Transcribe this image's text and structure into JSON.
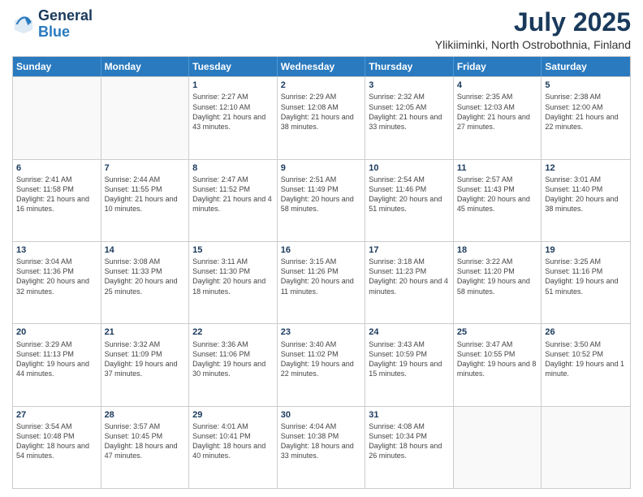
{
  "logo": {
    "line1": "General",
    "line2": "Blue"
  },
  "title": "July 2025",
  "subtitle": "Ylikiiminki, North Ostrobothnia, Finland",
  "header_days": [
    "Sunday",
    "Monday",
    "Tuesday",
    "Wednesday",
    "Thursday",
    "Friday",
    "Saturday"
  ],
  "weeks": [
    [
      {
        "day": "",
        "info": ""
      },
      {
        "day": "",
        "info": ""
      },
      {
        "day": "1",
        "info": "Sunrise: 2:27 AM\nSunset: 12:10 AM\nDaylight: 21 hours and 43 minutes."
      },
      {
        "day": "2",
        "info": "Sunrise: 2:29 AM\nSunset: 12:08 AM\nDaylight: 21 hours and 38 minutes."
      },
      {
        "day": "3",
        "info": "Sunrise: 2:32 AM\nSunset: 12:05 AM\nDaylight: 21 hours and 33 minutes."
      },
      {
        "day": "4",
        "info": "Sunrise: 2:35 AM\nSunset: 12:03 AM\nDaylight: 21 hours and 27 minutes."
      },
      {
        "day": "5",
        "info": "Sunrise: 2:38 AM\nSunset: 12:00 AM\nDaylight: 21 hours and 22 minutes."
      }
    ],
    [
      {
        "day": "6",
        "info": "Sunrise: 2:41 AM\nSunset: 11:58 PM\nDaylight: 21 hours and 16 minutes."
      },
      {
        "day": "7",
        "info": "Sunrise: 2:44 AM\nSunset: 11:55 PM\nDaylight: 21 hours and 10 minutes."
      },
      {
        "day": "8",
        "info": "Sunrise: 2:47 AM\nSunset: 11:52 PM\nDaylight: 21 hours and 4 minutes."
      },
      {
        "day": "9",
        "info": "Sunrise: 2:51 AM\nSunset: 11:49 PM\nDaylight: 20 hours and 58 minutes."
      },
      {
        "day": "10",
        "info": "Sunrise: 2:54 AM\nSunset: 11:46 PM\nDaylight: 20 hours and 51 minutes."
      },
      {
        "day": "11",
        "info": "Sunrise: 2:57 AM\nSunset: 11:43 PM\nDaylight: 20 hours and 45 minutes."
      },
      {
        "day": "12",
        "info": "Sunrise: 3:01 AM\nSunset: 11:40 PM\nDaylight: 20 hours and 38 minutes."
      }
    ],
    [
      {
        "day": "13",
        "info": "Sunrise: 3:04 AM\nSunset: 11:36 PM\nDaylight: 20 hours and 32 minutes."
      },
      {
        "day": "14",
        "info": "Sunrise: 3:08 AM\nSunset: 11:33 PM\nDaylight: 20 hours and 25 minutes."
      },
      {
        "day": "15",
        "info": "Sunrise: 3:11 AM\nSunset: 11:30 PM\nDaylight: 20 hours and 18 minutes."
      },
      {
        "day": "16",
        "info": "Sunrise: 3:15 AM\nSunset: 11:26 PM\nDaylight: 20 hours and 11 minutes."
      },
      {
        "day": "17",
        "info": "Sunrise: 3:18 AM\nSunset: 11:23 PM\nDaylight: 20 hours and 4 minutes."
      },
      {
        "day": "18",
        "info": "Sunrise: 3:22 AM\nSunset: 11:20 PM\nDaylight: 19 hours and 58 minutes."
      },
      {
        "day": "19",
        "info": "Sunrise: 3:25 AM\nSunset: 11:16 PM\nDaylight: 19 hours and 51 minutes."
      }
    ],
    [
      {
        "day": "20",
        "info": "Sunrise: 3:29 AM\nSunset: 11:13 PM\nDaylight: 19 hours and 44 minutes."
      },
      {
        "day": "21",
        "info": "Sunrise: 3:32 AM\nSunset: 11:09 PM\nDaylight: 19 hours and 37 minutes."
      },
      {
        "day": "22",
        "info": "Sunrise: 3:36 AM\nSunset: 11:06 PM\nDaylight: 19 hours and 30 minutes."
      },
      {
        "day": "23",
        "info": "Sunrise: 3:40 AM\nSunset: 11:02 PM\nDaylight: 19 hours and 22 minutes."
      },
      {
        "day": "24",
        "info": "Sunrise: 3:43 AM\nSunset: 10:59 PM\nDaylight: 19 hours and 15 minutes."
      },
      {
        "day": "25",
        "info": "Sunrise: 3:47 AM\nSunset: 10:55 PM\nDaylight: 19 hours and 8 minutes."
      },
      {
        "day": "26",
        "info": "Sunrise: 3:50 AM\nSunset: 10:52 PM\nDaylight: 19 hours and 1 minute."
      }
    ],
    [
      {
        "day": "27",
        "info": "Sunrise: 3:54 AM\nSunset: 10:48 PM\nDaylight: 18 hours and 54 minutes."
      },
      {
        "day": "28",
        "info": "Sunrise: 3:57 AM\nSunset: 10:45 PM\nDaylight: 18 hours and 47 minutes."
      },
      {
        "day": "29",
        "info": "Sunrise: 4:01 AM\nSunset: 10:41 PM\nDaylight: 18 hours and 40 minutes."
      },
      {
        "day": "30",
        "info": "Sunrise: 4:04 AM\nSunset: 10:38 PM\nDaylight: 18 hours and 33 minutes."
      },
      {
        "day": "31",
        "info": "Sunrise: 4:08 AM\nSunset: 10:34 PM\nDaylight: 18 hours and 26 minutes."
      },
      {
        "day": "",
        "info": ""
      },
      {
        "day": "",
        "info": ""
      }
    ]
  ]
}
